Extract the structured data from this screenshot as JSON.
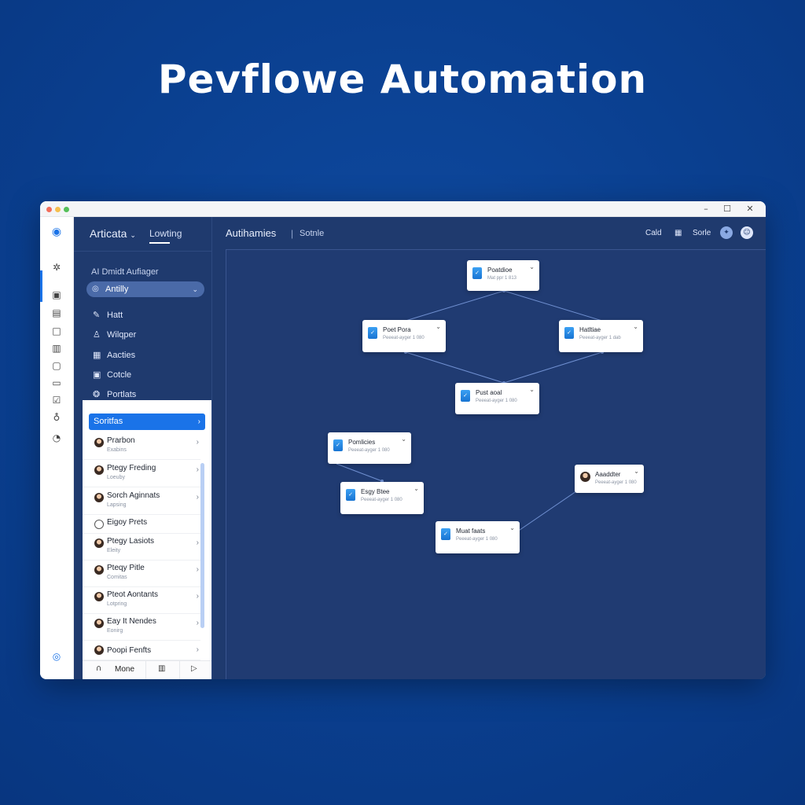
{
  "headline": "Pevflowe Automation",
  "titlebar": {
    "minimize": "–",
    "maximize": "☐",
    "close": "✕"
  },
  "colors": {
    "accent": "#1a73e8",
    "background": "#0a3f8f",
    "panel": "#1f3a6e"
  },
  "left_panel": {
    "title": "Articata",
    "tab": "Lowting",
    "section_label": "AI Dmidt Aufiager",
    "dropdown_value": "Antilly",
    "nav": [
      {
        "icon": "wrench-icon",
        "label": "Hatt"
      },
      {
        "icon": "users-icon",
        "label": "Wilqper"
      },
      {
        "icon": "grid-icon",
        "label": "Aacties"
      },
      {
        "icon": "box-icon",
        "label": "Cotcle"
      },
      {
        "icon": "globe-icon",
        "label": "Portlats"
      }
    ]
  },
  "list": {
    "selected": "Soritfas",
    "items": [
      {
        "name": "Prarbon",
        "sub": "Exabins"
      },
      {
        "name": "Ptegy Freding",
        "sub": "Loeuby"
      },
      {
        "name": "Sorch Aginnats",
        "sub": "Lapsing"
      },
      {
        "name": "Eigoy Prets",
        "sub": ""
      },
      {
        "name": "Ptegy Lasiots",
        "sub": "Eleity"
      },
      {
        "name": "Pteqy Pitle",
        "sub": "Comitas"
      },
      {
        "name": "Pteot Aontants",
        "sub": "Lotpring"
      },
      {
        "name": "Eay It Nendes",
        "sub": "Eonirg"
      },
      {
        "name": "Poopi Fenfts",
        "sub": ""
      }
    ],
    "footer_more": "Mone"
  },
  "main": {
    "title": "Autihamies",
    "subtitle": "Sotnle",
    "right_label_1": "Cald",
    "right_label_2": "Sorle"
  },
  "nodes": [
    {
      "title": "Poatdioe",
      "sub": "Mat ppr 1 813"
    },
    {
      "title": "Poet Pora",
      "sub": "Peeeat-ayger 1 080"
    },
    {
      "title": "Hatltiae",
      "sub": "Peeeat-ayger 1 dab"
    },
    {
      "title": "Pust aoal",
      "sub": "Peeeat-ayger 1 080"
    },
    {
      "title": "Pomlicies",
      "sub": "Peeeat-ayger 1 080"
    },
    {
      "title": "Esgy Btee",
      "sub": "Peeeat-ayger 1 080"
    },
    {
      "title": "Aaaddter",
      "sub": "Peeeat-ayger 1 080"
    },
    {
      "title": "Muat faats",
      "sub": "Peeeat-ayger 1 080"
    }
  ]
}
